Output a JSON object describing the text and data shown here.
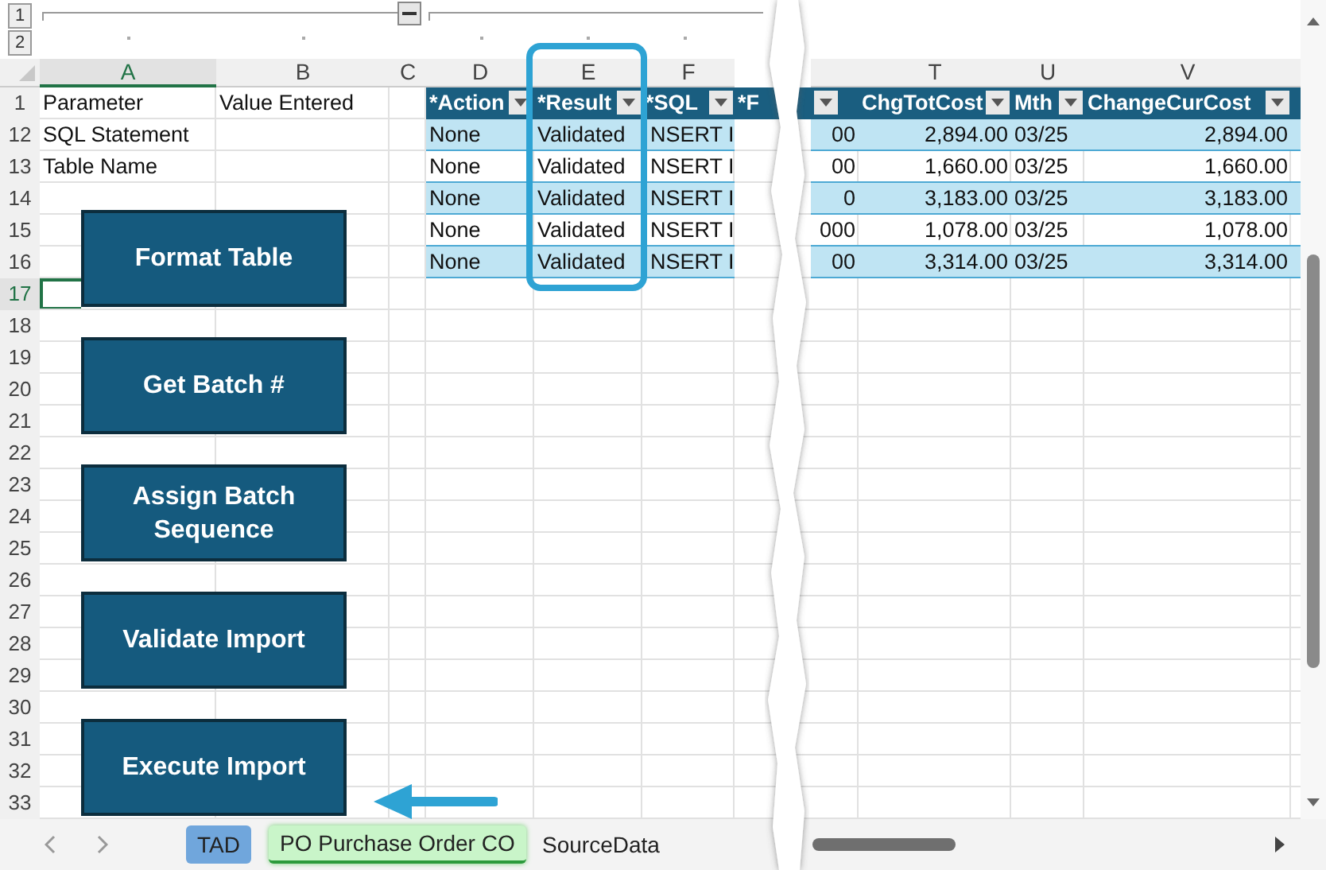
{
  "outline": {
    "levels": [
      "1",
      "2"
    ]
  },
  "columns": [
    {
      "kind": "cell",
      "letter": "A",
      "selected": true
    },
    {
      "kind": "cell",
      "letter": "B",
      "selected": false
    },
    {
      "kind": "cell",
      "letter": "C",
      "selected": false
    },
    {
      "kind": "cell",
      "letter": "D",
      "selected": false
    },
    {
      "kind": "cell",
      "letter": "E",
      "selected": false
    },
    {
      "kind": "cell",
      "letter": "F",
      "selected": false
    },
    {
      "kind": "tear"
    },
    {
      "kind": "cell"
    },
    {
      "kind": "cell",
      "letter": "T",
      "selected": false
    },
    {
      "kind": "cell",
      "letter": "U",
      "selected": false
    },
    {
      "kind": "cell",
      "letter": "V",
      "selected": false
    },
    {
      "kind": "cell"
    }
  ],
  "rows": [
    {
      "number": "1",
      "selected": false,
      "a": "Parameter",
      "b": "Value Entered"
    },
    {
      "number": "12",
      "selected": false,
      "a": "SQL Statement"
    },
    {
      "number": "13",
      "selected": false,
      "a": "Table Name"
    },
    {
      "number": "14",
      "selected": false
    },
    {
      "number": "15",
      "selected": false
    },
    {
      "number": "16",
      "selected": false
    },
    {
      "number": "17",
      "selected": true
    },
    {
      "number": "18",
      "selected": false
    },
    {
      "number": "19",
      "selected": false
    },
    {
      "number": "20",
      "selected": false
    },
    {
      "number": "21",
      "selected": false
    },
    {
      "number": "22",
      "selected": false
    },
    {
      "number": "23",
      "selected": false
    },
    {
      "number": "24",
      "selected": false
    },
    {
      "number": "25",
      "selected": false
    },
    {
      "number": "26",
      "selected": false
    },
    {
      "number": "27",
      "selected": false
    },
    {
      "number": "28",
      "selected": false
    },
    {
      "number": "29",
      "selected": false
    },
    {
      "number": "30",
      "selected": false
    },
    {
      "number": "31",
      "selected": false
    },
    {
      "number": "32",
      "selected": false
    },
    {
      "number": "33",
      "selected": false
    }
  ],
  "table": {
    "headers": [
      {
        "label": "*Action",
        "filter": true,
        "highlighted": false
      },
      {
        "label": "*Result",
        "filter": true,
        "highlighted": true
      },
      {
        "label": "*SQL",
        "filter": true,
        "highlighted": false
      },
      {
        "label": "*F",
        "filter": false,
        "highlighted": false
      },
      {
        "filter": true,
        "highlighted": false
      },
      {
        "label": "ChgTotCost",
        "filter": true,
        "highlighted": false
      },
      {
        "label": "Mth",
        "filter": true,
        "highlighted": false
      },
      {
        "label": "ChangeCurCost",
        "filter": true,
        "highlighted": false
      },
      {
        "filter": false,
        "highlighted": false
      }
    ],
    "rows": [
      {
        "action": "None",
        "result": "Validated",
        "sql": "NSERT I",
        "cut": "00",
        "chg_tot_cost": "2,894.00",
        "mth": "03/25",
        "change_cur_cost": "2,894.00"
      },
      {
        "action": "None",
        "result": "Validated",
        "sql": "NSERT I",
        "cut": "00",
        "chg_tot_cost": "1,660.00",
        "mth": "03/25",
        "change_cur_cost": "1,660.00"
      },
      {
        "action": "None",
        "result": "Validated",
        "sql": "NSERT I",
        "cut": "0",
        "chg_tot_cost": "3,183.00",
        "mth": "03/25",
        "change_cur_cost": "3,183.00"
      },
      {
        "action": "None",
        "result": "Validated",
        "sql": "NSERT I",
        "cut": "000",
        "chg_tot_cost": "1,078.00",
        "mth": "03/25",
        "change_cur_cost": "1,078.00"
      },
      {
        "action": "None",
        "result": "Validated",
        "sql": "NSERT I",
        "cut": "00",
        "chg_tot_cost": "3,314.00",
        "mth": "03/25",
        "change_cur_cost": "3,314.00"
      }
    ]
  },
  "action_buttons": [
    {
      "label": "Format Table",
      "pointed": false
    },
    {
      "label": "Get Batch #",
      "pointed": false
    },
    {
      "label": "Assign Batch Sequence",
      "pointed": false
    },
    {
      "label": "Validate Import",
      "pointed": false
    },
    {
      "label": "Execute Import",
      "pointed": true
    }
  ],
  "sheet_tabs": [
    {
      "label": "TAD",
      "selected": false,
      "color": "#70a6dc"
    },
    {
      "label": "PO Purchase Order CO",
      "selected": true,
      "color": "#c9f5c9"
    },
    {
      "label": "SourceData",
      "selected": false
    }
  ]
}
